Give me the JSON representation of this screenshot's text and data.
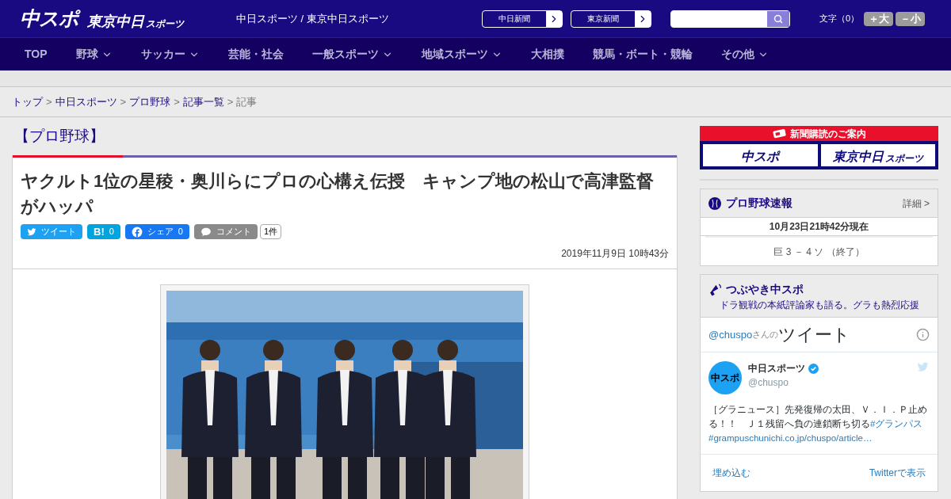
{
  "header": {
    "logo_main": "中スポ",
    "logo_sub": "東京中日",
    "logo_sub_small": "スポーツ",
    "site_title": "中日スポーツ / 東京中日スポーツ",
    "paper_links": [
      "中日新聞",
      "東京新聞"
    ],
    "font_size_label": "文字（0）",
    "font_buttons": [
      "＋大",
      "－小"
    ]
  },
  "nav": [
    {
      "label": "TOP",
      "dropdown": false
    },
    {
      "label": "野球",
      "dropdown": true
    },
    {
      "label": "サッカー",
      "dropdown": true
    },
    {
      "label": "芸能・社会",
      "dropdown": false
    },
    {
      "label": "一般スポーツ",
      "dropdown": true
    },
    {
      "label": "地域スポーツ",
      "dropdown": true
    },
    {
      "label": "大相撲",
      "dropdown": false
    },
    {
      "label": "競馬・ボート・競輪",
      "dropdown": false
    },
    {
      "label": "その他",
      "dropdown": true
    }
  ],
  "breadcrumb": {
    "separator": ">",
    "items": [
      {
        "label": "トップ",
        "link": true
      },
      {
        "label": "中日スポーツ",
        "link": true
      },
      {
        "label": "プロ野球",
        "link": true
      },
      {
        "label": "記事一覧",
        "link": true
      },
      {
        "label": "記事",
        "link": false
      }
    ]
  },
  "category": "【プロ野球】",
  "article": {
    "title": "ヤクルト1位の星稜・奥川らにプロの心構え伝授　キャンプ地の松山で高津監督がハッパ",
    "share": [
      {
        "kind": "twitter",
        "label": "ツイート"
      },
      {
        "kind": "hatena",
        "label": "B!",
        "count": "0"
      },
      {
        "kind": "facebook",
        "label": "シェア",
        "count": "0"
      },
      {
        "kind": "comment",
        "label": "コメント"
      }
    ],
    "comment_count": "1件",
    "date": "2019年11月9日 10時43分"
  },
  "sidebar": {
    "subscribe": {
      "title": "新聞購読のご案内",
      "logos": [
        "中スポ",
        "東京中日"
      ],
      "logo_small": "スポーツ"
    },
    "scores": {
      "title": "プロ野球速報",
      "more": "詳細 >",
      "updated": "10月23日21時42分現在",
      "games": [
        "巨 3 － 4 ソ （終了）"
      ]
    },
    "tweets": {
      "title": "つぶやき中スポ",
      "subtitle": "ドラ観戦の本紙評論家も語る。グラも熱烈応援",
      "handle_link": "@chuspo",
      "handle_suffix": "さんの",
      "heading": "ツイート",
      "tweet": {
        "avatar": "中スポ",
        "name": "中日スポーツ",
        "verified": true,
        "handle": "@chuspo",
        "parts": [
          {
            "kind": "plain",
            "text": "［グラニュース］先発復帰の太田、Ｖ．Ｉ．Ｐ止める！！　Ｊ１残留へ負の連鎖断ち切る"
          },
          {
            "kind": "link",
            "text": "#グランパス"
          },
          {
            "kind": "link",
            "text": "#grampuschunichi.co.jp/chuspo/article…"
          }
        ]
      },
      "footer_links": [
        "埋め込む",
        "Twitterで表示"
      ]
    }
  }
}
